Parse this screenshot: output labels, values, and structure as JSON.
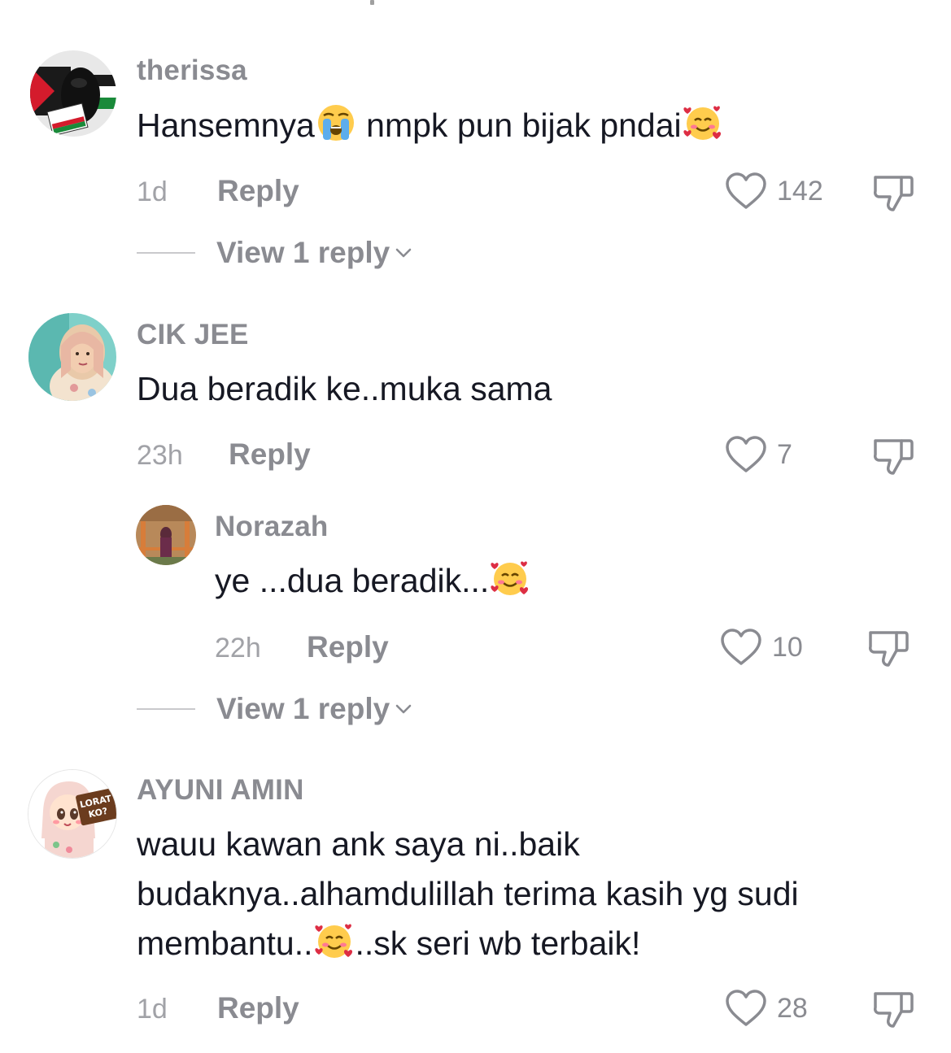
{
  "comments": [
    {
      "username": "therissa",
      "text_parts": [
        "Hansemnya",
        " nmpk pun bijak pndai"
      ],
      "emojis": [
        "loudly-crying-face-emoji",
        "smiling-face-with-hearts-emoji"
      ],
      "time": "1d",
      "reply_label": "Reply",
      "likes": "142",
      "view_replies": "View 1 reply"
    },
    {
      "username": "CIK JEE",
      "text": "Dua beradik ke..muka sama",
      "time": "23h",
      "reply_label": "Reply",
      "likes": "7",
      "replies": [
        {
          "username": "Norazah",
          "text": "ye ...dua beradik...",
          "emojis": [
            "smiling-face-with-hearts-emoji"
          ],
          "time": "22h",
          "reply_label": "Reply",
          "likes": "10"
        }
      ],
      "view_replies": "View 1 reply"
    },
    {
      "username": "AYUNI AMIN",
      "lines": [
        "wauu kawan ank saya ni..baik",
        "budaknya..alhamdulillah terima kasih yg sudi",
        "membantu..",
        "..sk seri wb terbaik!"
      ],
      "emojis": [
        "smiling-face-with-hearts-emoji"
      ],
      "avatar_sticker_text": "LORAT KO?",
      "time": "1d",
      "reply_label": "Reply",
      "likes": "28"
    }
  ],
  "colors": {
    "text": "#161823",
    "secondary": "#8a8b91",
    "tertiary": "#a1a2a7",
    "background": "#ffffff"
  }
}
